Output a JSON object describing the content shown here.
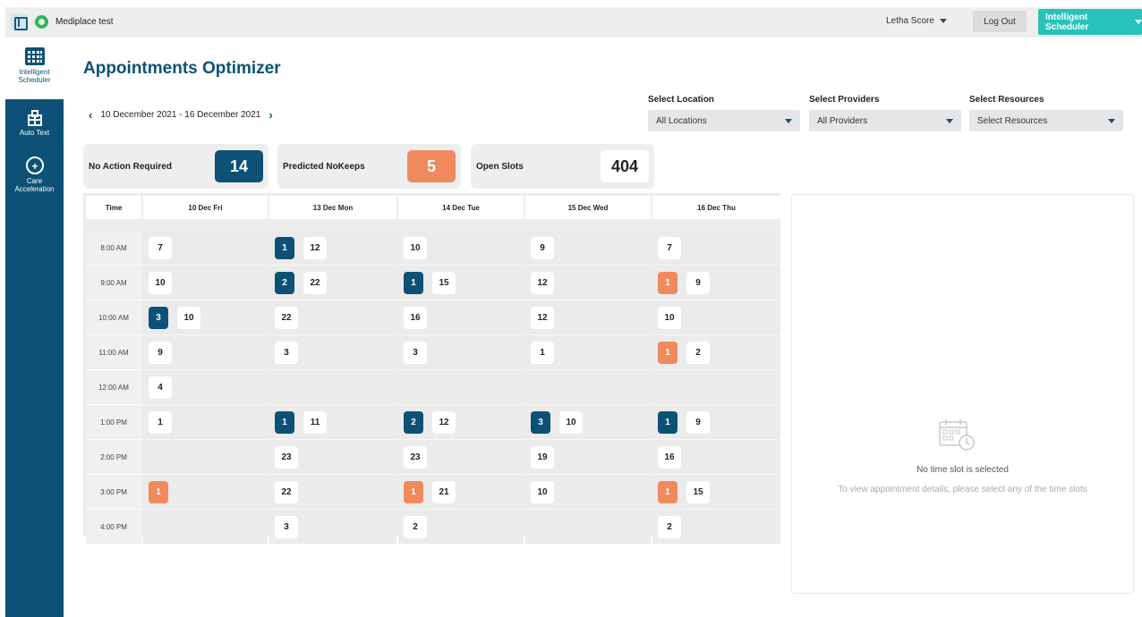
{
  "app": {
    "title": "Mediplace test"
  },
  "header": {
    "user": "Letha Score",
    "logout_label": "Log Out",
    "module_label": "Intelligent Scheduler"
  },
  "sidebar": {
    "items": [
      {
        "label": "Intelligent Scheduler",
        "icon": "calendar-grid-icon",
        "active": true
      },
      {
        "label": "Auto Text",
        "icon": "building-icon",
        "active": false
      },
      {
        "label": "Care Acceleration",
        "icon": "gauge-icon",
        "active": false
      }
    ]
  },
  "page": {
    "title": "Appointments Optimizer"
  },
  "date_range": {
    "label": "10 December 2021 - 16 December 2021"
  },
  "filters": [
    {
      "label": "Select Location",
      "value": "All Locations"
    },
    {
      "label": "Select Providers",
      "value": "All Providers"
    },
    {
      "label": "Select Resources",
      "value": "Select Resources"
    }
  ],
  "kpis": [
    {
      "label": "No Action Required",
      "value": "14",
      "color": "#0d5276"
    },
    {
      "label": "Predicted NoKeeps",
      "value": "5",
      "color": "#f08a5d"
    },
    {
      "label": "Open Slots",
      "value": "404",
      "color": "#ffffff"
    }
  ],
  "schedule": {
    "time_header": "Time",
    "days": [
      "10 Dec Fri",
      "13 Dec Mon",
      "14 Dec Tue",
      "15 Dec Wed",
      "16 Dec Thu"
    ],
    "rows": [
      {
        "time": "8:00 AM",
        "cells": [
          {
            "count": "7"
          },
          {
            "blue": "1",
            "count": "12"
          },
          {
            "count": "10"
          },
          {
            "count": "9"
          },
          {
            "count": "7"
          }
        ]
      },
      {
        "time": "9:00 AM",
        "cells": [
          {
            "count": "10"
          },
          {
            "blue": "2",
            "count": "22"
          },
          {
            "blue": "1",
            "count": "15"
          },
          {
            "count": "12"
          },
          {
            "orange": "1",
            "count": "9"
          }
        ]
      },
      {
        "time": "10:00 AM",
        "cells": [
          {
            "blue": "3",
            "count": "10"
          },
          {
            "count": "22"
          },
          {
            "count": "16"
          },
          {
            "count": "12"
          },
          {
            "count": "10"
          }
        ]
      },
      {
        "time": "11:00 AM",
        "cells": [
          {
            "count": "9"
          },
          {
            "count": "3"
          },
          {
            "count": "3"
          },
          {
            "count": "1"
          },
          {
            "orange": "1",
            "count": "2"
          }
        ]
      },
      {
        "time": "12:00 AM",
        "cells": [
          {
            "count": "4"
          },
          {},
          {},
          {},
          {}
        ]
      },
      {
        "time": "1:00 PM",
        "cells": [
          {
            "count": "1"
          },
          {
            "blue": "1",
            "count": "11"
          },
          {
            "blue": "2",
            "count": "12"
          },
          {
            "blue": "3",
            "count": "10"
          },
          {
            "blue": "1",
            "count": "9"
          }
        ]
      },
      {
        "time": "2:00 PM",
        "cells": [
          {},
          {
            "count": "23"
          },
          {
            "count": "23"
          },
          {
            "count": "19"
          },
          {
            "count": "16"
          }
        ]
      },
      {
        "time": "3:00 PM",
        "cells": [
          {
            "orange": "1"
          },
          {
            "count": "22"
          },
          {
            "orange": "1",
            "count": "21"
          },
          {
            "count": "10"
          },
          {
            "orange": "1",
            "count": "15"
          }
        ]
      },
      {
        "time": "4:00 PM",
        "cells": [
          {},
          {
            "count": "3"
          },
          {
            "count": "2"
          },
          {},
          {
            "count": "2"
          }
        ]
      }
    ]
  },
  "details": {
    "empty_title": "No time slot is selected",
    "empty_subtitle": "To view appointment details, please select any of the time slots"
  }
}
